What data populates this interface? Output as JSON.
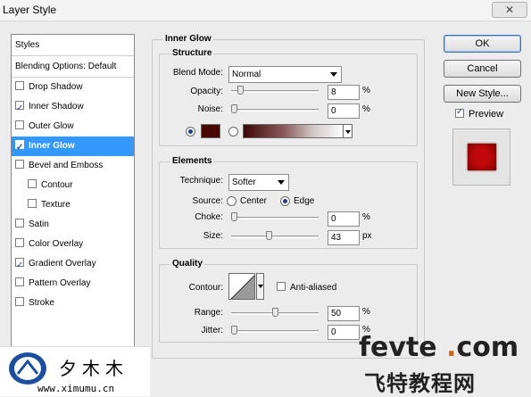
{
  "window": {
    "title": "Layer Style",
    "close_label": "✕"
  },
  "styles_panel": {
    "header": "Styles",
    "blending": "Blending Options: Default",
    "items": [
      {
        "label": "Drop Shadow",
        "checked": false,
        "selected": false,
        "indent": false
      },
      {
        "label": "Inner Shadow",
        "checked": true,
        "selected": false,
        "indent": false
      },
      {
        "label": "Outer Glow",
        "checked": false,
        "selected": false,
        "indent": false
      },
      {
        "label": "Inner Glow",
        "checked": true,
        "selected": true,
        "indent": false
      },
      {
        "label": "Bevel and Emboss",
        "checked": false,
        "selected": false,
        "indent": false
      },
      {
        "label": "Contour",
        "checked": false,
        "selected": false,
        "indent": true
      },
      {
        "label": "Texture",
        "checked": false,
        "selected": false,
        "indent": true
      },
      {
        "label": "Satin",
        "checked": false,
        "selected": false,
        "indent": false
      },
      {
        "label": "Color Overlay",
        "checked": false,
        "selected": false,
        "indent": false
      },
      {
        "label": "Gradient Overlay",
        "checked": true,
        "selected": false,
        "indent": false
      },
      {
        "label": "Pattern Overlay",
        "checked": false,
        "selected": false,
        "indent": false
      },
      {
        "label": "Stroke",
        "checked": false,
        "selected": false,
        "indent": false
      }
    ]
  },
  "inner_glow": {
    "title": "Inner Glow",
    "structure": {
      "title": "Structure",
      "blend_mode_label": "Blend Mode:",
      "blend_mode_value": "Normal",
      "opacity_label": "Opacity:",
      "opacity_value": "8",
      "opacity_level": 8,
      "noise_label": "Noise:",
      "noise_value": "0",
      "noise_level": 0,
      "unit": "%",
      "color_selected": true,
      "color": "#4a0605"
    },
    "elements": {
      "title": "Elements",
      "technique_label": "Technique:",
      "technique_value": "Softer",
      "source_label": "Source:",
      "source_center": "Center",
      "source_edge": "Edge",
      "source_selected": "Edge",
      "choke_label": "Choke:",
      "choke_value": "0",
      "choke_level": 0,
      "choke_unit": "%",
      "size_label": "Size:",
      "size_value": "43",
      "size_level": 43,
      "size_unit": "px"
    },
    "quality": {
      "title": "Quality",
      "contour_label": "Contour:",
      "anti_aliased_label": "Anti-aliased",
      "anti_aliased": false,
      "range_label": "Range:",
      "range_value": "50",
      "range_level": 50,
      "range_unit": "%",
      "jitter_label": "Jitter:",
      "jitter_value": "0",
      "jitter_level": 0,
      "jitter_unit": "%"
    }
  },
  "buttons": {
    "ok": "OK",
    "cancel": "Cancel",
    "new_style": "New Style...",
    "preview_label": "Preview",
    "preview_checked": true
  },
  "watermarks": {
    "left_cn": "夕木木",
    "left_url": "www.ximumu.cn",
    "right_fevte_a": "fevte",
    "right_fevte_dot": ".",
    "right_fevte_b": "com",
    "right_cn": "飞特教程网"
  }
}
